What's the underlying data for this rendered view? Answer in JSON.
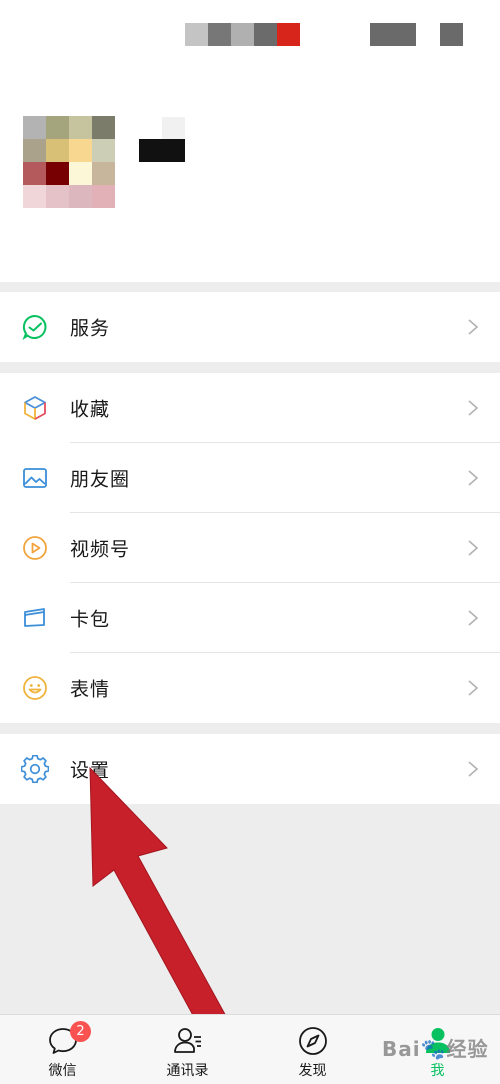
{
  "status_bar": {
    "blocks": [
      "#c4c4c4",
      "#777777",
      "#b0b0b0",
      "#6b6b6b",
      "#d8251b",
      "#6a6a6a",
      "#6a6a6a"
    ]
  },
  "profile": {
    "avatar_colors": [
      "#b3b3b3",
      "#a4a47d",
      "#c6c49e",
      "#7c7c6a",
      "#aaa28a",
      "#d8c077",
      "#f8d790",
      "#cccfb6",
      "#b55a5c",
      "#770003",
      "#fbf7d7",
      "#c7b59c",
      "#f0d6d8",
      "#e5c2c8",
      "#dcb8be",
      "#e1b1b7"
    ]
  },
  "menu": {
    "group1": [
      {
        "label": "服务",
        "icon": "service-icon"
      }
    ],
    "group2": [
      {
        "label": "收藏",
        "icon": "favorites-cube-icon"
      },
      {
        "label": "朋友圈",
        "icon": "moments-image-icon"
      },
      {
        "label": "视频号",
        "icon": "channels-play-icon"
      },
      {
        "label": "卡包",
        "icon": "card-wallet-icon"
      },
      {
        "label": "表情",
        "icon": "sticker-smiley-icon"
      }
    ],
    "group3": [
      {
        "label": "设置",
        "icon": "settings-gear-icon"
      }
    ]
  },
  "tabbar": {
    "tabs": [
      {
        "label": "微信",
        "icon": "chat-bubble-icon",
        "badge": "2"
      },
      {
        "label": "通讯录",
        "icon": "contacts-icon"
      },
      {
        "label": "发现",
        "icon": "discover-compass-icon"
      },
      {
        "label": "我",
        "icon": "me-person-icon",
        "active": true
      }
    ],
    "active_color": "#07c160"
  },
  "watermark": {
    "text": "Bai🐾经验"
  },
  "colors": {
    "accent_green": "#07c160",
    "badge_red": "#fa5151",
    "arrow_red": "#c8202a"
  }
}
